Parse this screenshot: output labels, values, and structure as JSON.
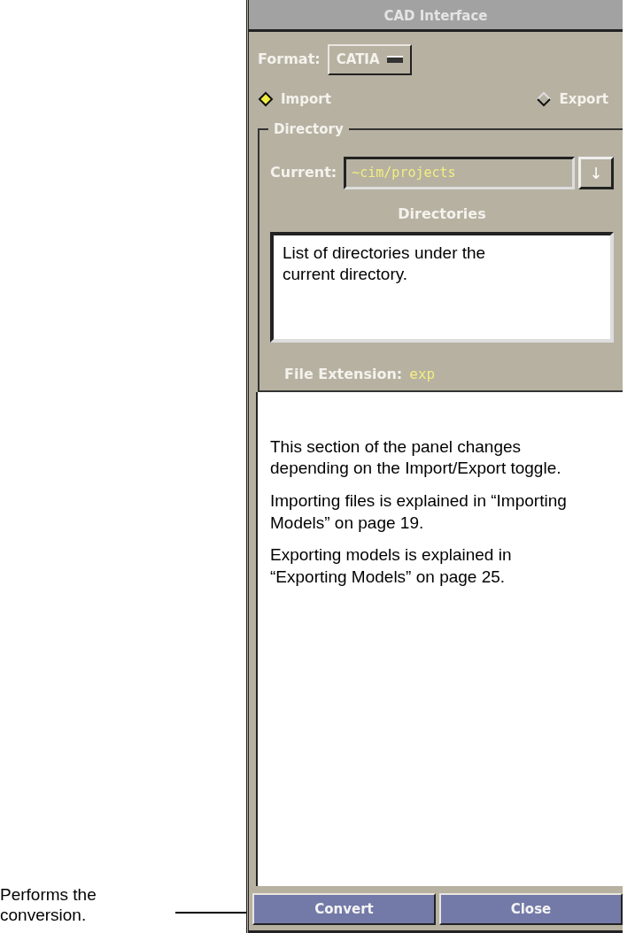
{
  "window": {
    "title": "CAD Interface"
  },
  "format": {
    "label": "Format:",
    "value": "CATIA"
  },
  "mode_toggle": [
    {
      "label": "Import",
      "selected": true
    },
    {
      "label": "Export",
      "selected": false
    }
  ],
  "directory": {
    "title": "Directory",
    "current_label": "Current:",
    "current_value": "~cim/projects",
    "current_button": "↓",
    "list_label": "Directories",
    "list_note": "List of directories under the current directory.",
    "extension_label": "File Extension:",
    "extension_value": "exp"
  },
  "section_note": [
    "This section of the panel changes depending on the Import/Export toggle.",
    "Importing files is explained in “Importing Models” on page 19.",
    "Exporting models is explained in “Exporting Models” on page 25."
  ],
  "buttons": [
    "Convert",
    "Close"
  ],
  "annotation": "Performs the conversion."
}
